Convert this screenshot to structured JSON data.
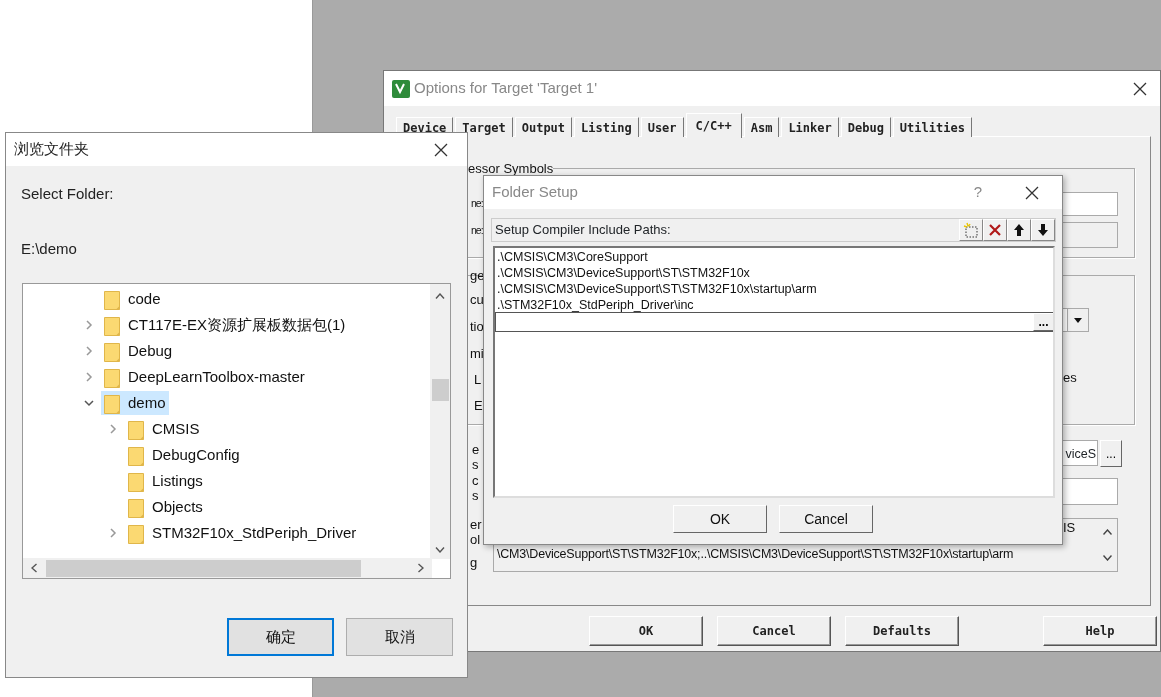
{
  "options_dialog": {
    "title": "Options for Target 'Target 1'",
    "tabs": [
      {
        "label": "Device",
        "selected": false
      },
      {
        "label": "Target",
        "selected": false
      },
      {
        "label": "Output",
        "selected": false
      },
      {
        "label": "Listing",
        "selected": false
      },
      {
        "label": "User",
        "selected": false
      },
      {
        "label": "C/C++",
        "selected": true
      },
      {
        "label": "Asm",
        "selected": false
      },
      {
        "label": "Linker",
        "selected": false
      },
      {
        "label": "Debug",
        "selected": false
      },
      {
        "label": "Utilities",
        "selected": false
      }
    ],
    "visible_fragments": [
      {
        "text": "essor Symbols",
        "kind": "legend"
      },
      {
        "text": "ne:",
        "kind": "label"
      },
      {
        "text": "ne:",
        "kind": "label"
      },
      {
        "text": "ge",
        "kind": "label"
      },
      {
        "text": "cu",
        "kind": "label"
      },
      {
        "text": "tio",
        "kind": "label"
      },
      {
        "text": "mi",
        "kind": "label"
      },
      {
        "text": "L",
        "kind": "label"
      },
      {
        "text": "E",
        "kind": "label"
      },
      {
        "text": "e",
        "kind": "label"
      },
      {
        "text": "s",
        "kind": "label"
      },
      {
        "text": "c",
        "kind": "label"
      },
      {
        "text": "s",
        "kind": "label"
      },
      {
        "text": "er",
        "kind": "label"
      },
      {
        "text": "ol",
        "kind": "label"
      },
      {
        "text": "g",
        "kind": "label"
      },
      {
        "text": "es",
        "kind": "label"
      },
      {
        "text": "IS",
        "kind": "value"
      },
      {
        "text": "\\CM3\\DeviceSupport\\ST\\STM32F10x;..\\CMSIS\\CM3\\DeviceSupport\\ST\\STM32F10x\\startup\\arm",
        "kind": "value"
      }
    ],
    "include_field_value": "viceS",
    "browse_button": "...",
    "buttons": [
      "OK",
      "Cancel",
      "Defaults",
      "Help"
    ]
  },
  "browse_dialog": {
    "title": "浏览文件夹",
    "prompt": "Select Folder:",
    "path": "E:\\demo",
    "tree": [
      {
        "label": "code",
        "selected": false
      },
      {
        "label": "CT117E-EX资源扩展板数据包(1)",
        "expanded": false,
        "selected": false
      },
      {
        "label": "Debug",
        "expanded": false,
        "selected": false
      },
      {
        "label": "DeepLearnToolbox-master",
        "expanded": false,
        "selected": false
      },
      {
        "label": "demo",
        "expanded": true,
        "selected": true,
        "children": [
          {
            "label": "CMSIS",
            "expanded": false,
            "selected": false
          },
          {
            "label": "DebugConfig",
            "selected": false
          },
          {
            "label": "Listings",
            "selected": false
          },
          {
            "label": "Objects",
            "selected": false
          },
          {
            "label": "STM32F10x_StdPeriph_Driver",
            "expanded": false,
            "selected": false
          }
        ]
      }
    ],
    "buttons": [
      {
        "label": "确定",
        "default": true
      },
      {
        "label": "取消",
        "default": false
      }
    ]
  },
  "folder_setup": {
    "title": "Folder Setup",
    "help": "?",
    "header": "Setup Compiler Include Paths:",
    "paths": [
      ".\\CMSIS\\CM3\\CoreSupport",
      ".\\CMSIS\\CM3\\DeviceSupport\\ST\\STM32F10x",
      ".\\CMSIS\\CM3\\DeviceSupport\\ST\\STM32F10x\\startup\\arm",
      ".\\STM32F10x_StdPeriph_Driver\\inc"
    ],
    "browse_button": "...",
    "buttons": [
      "OK",
      "Cancel"
    ]
  }
}
